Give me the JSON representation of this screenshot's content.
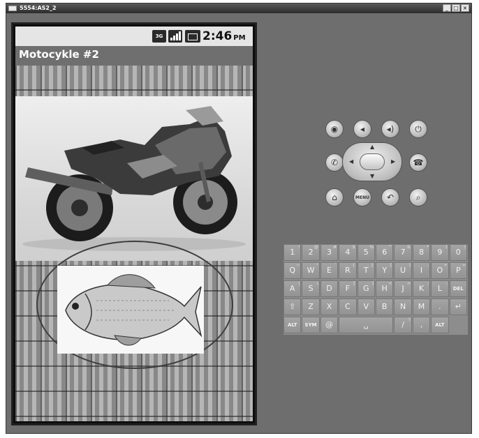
{
  "window": {
    "title": "5554:AS2_2",
    "buttons": {
      "minimize": "_",
      "maximize": "□",
      "close": "×"
    }
  },
  "status_bar": {
    "network": "3G",
    "time": "2:46",
    "ampm": "PM",
    "icons": [
      "3g-icon",
      "signal-icon",
      "battery-icon"
    ]
  },
  "app": {
    "title": "Motocykle #2",
    "images": [
      "motorcycle-image",
      "fish-image"
    ]
  },
  "hardware_buttons": {
    "row1": [
      "camera-icon",
      "volume-down-icon",
      "volume-up-icon",
      "power-icon"
    ],
    "row2": [
      "call-icon",
      "end-call-icon"
    ],
    "row3": [
      "home-icon",
      "menu",
      "back-icon",
      "search-icon"
    ],
    "menu_label": "MENU"
  },
  "keyboard": {
    "row1": [
      {
        "k": "1",
        "s": "!"
      },
      {
        "k": "2",
        "s": "@"
      },
      {
        "k": "3",
        "s": "#"
      },
      {
        "k": "4",
        "s": "$"
      },
      {
        "k": "5",
        "s": "%"
      },
      {
        "k": "6",
        "s": "^"
      },
      {
        "k": "7",
        "s": "&"
      },
      {
        "k": "8",
        "s": "*"
      },
      {
        "k": "9",
        "s": "("
      },
      {
        "k": "0",
        "s": ")"
      }
    ],
    "row2": [
      {
        "k": "Q",
        "s": "~"
      },
      {
        "k": "W",
        "s": "\""
      },
      {
        "k": "E",
        "s": "`"
      },
      {
        "k": "R",
        "s": "{"
      },
      {
        "k": "T",
        "s": "}"
      },
      {
        "k": "Y",
        "s": "["
      },
      {
        "k": "U",
        "s": "]"
      },
      {
        "k": "I",
        "s": "-"
      },
      {
        "k": "O",
        "s": "+"
      },
      {
        "k": "P",
        "s": "="
      }
    ],
    "row3": [
      {
        "k": "A",
        "s": "|"
      },
      {
        "k": "S",
        "s": "\\"
      },
      {
        "k": "D",
        "s": ""
      },
      {
        "k": "F",
        "s": "["
      },
      {
        "k": "G",
        "s": "]"
      },
      {
        "k": "H",
        "s": "<"
      },
      {
        "k": "J",
        "s": ">"
      },
      {
        "k": "K",
        "s": ";"
      },
      {
        "k": "L",
        "s": ":"
      },
      {
        "k": "DEL",
        "s": ""
      }
    ],
    "row4": [
      {
        "k": "⇧",
        "s": ""
      },
      {
        "k": "Z",
        "s": ""
      },
      {
        "k": "X",
        "s": ""
      },
      {
        "k": "C",
        "s": ""
      },
      {
        "k": "V",
        "s": ""
      },
      {
        "k": "B",
        "s": ""
      },
      {
        "k": "N",
        "s": ""
      },
      {
        "k": "M",
        "s": ""
      },
      {
        "k": ".",
        "s": ""
      },
      {
        "k": "↵",
        "s": ""
      }
    ],
    "row5": [
      {
        "k": "ALT",
        "s": ""
      },
      {
        "k": "SYM",
        "s": ""
      },
      {
        "k": "@",
        "s": ""
      },
      {
        "k": "␣",
        "s": ""
      },
      {
        "k": "/",
        "s": "?"
      },
      {
        "k": ",",
        "s": ""
      },
      {
        "k": "ALT",
        "s": ""
      }
    ]
  },
  "colors": {
    "window_bg": "#6e6e6e",
    "app_bar": "#6f6f6f",
    "keyboard_bg": "#8d8d8d"
  }
}
